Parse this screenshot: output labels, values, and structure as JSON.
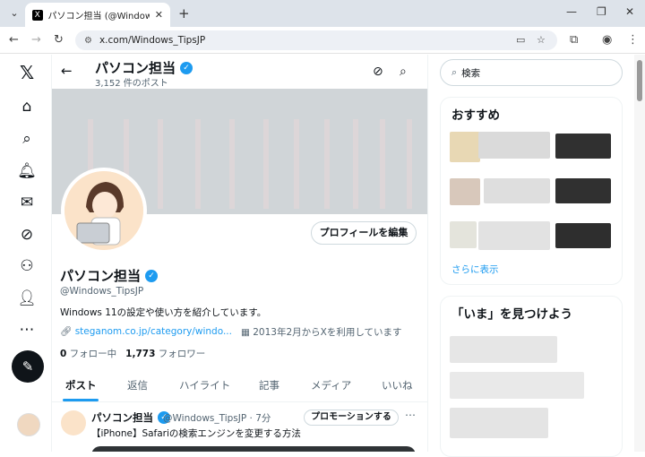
{
  "browser": {
    "tab_title": "パソコン担当 (@Windows_TipsJP)",
    "tab_favicon": "X",
    "url": "x.com/Windows_TipsJP"
  },
  "sidebar_icons": [
    "x-logo-icon",
    "home-icon",
    "explore-icon",
    "notifications-icon",
    "messages-icon",
    "grok-icon",
    "communities-icon",
    "profile-icon",
    "more-icon"
  ],
  "header": {
    "name": "パソコン担当",
    "post_count": "3,152 件のポスト"
  },
  "profile": {
    "edit_label": "プロフィールを編集",
    "name": "パソコン担当",
    "handle": "@Windows_TipsJP",
    "bio": "Windows 11の設定や使い方を紹介しています。",
    "link": "steganom.co.jp/category/windo...",
    "joined": "2013年2月からXを利用しています",
    "following_count": "0",
    "following_label": "フォロー中",
    "followers_count": "1,773",
    "followers_label": "フォロワー"
  },
  "tabs": [
    "ポスト",
    "返信",
    "ハイライト",
    "記事",
    "メディア",
    "いいね"
  ],
  "post": {
    "name": "パソコン担当",
    "meta": "@Windows_TipsJP · 7分",
    "promote_label": "プロモーションする",
    "text": "【iPhone】Safariの検索エンジンを変更する方法"
  },
  "right": {
    "search_placeholder": "検索",
    "recommend_title": "おすすめ",
    "show_more": "さらに表示",
    "trends_title": "「いま」を見つけよう"
  },
  "colors": {
    "accent": "#1d9bf0",
    "text": "#0f1419",
    "muted": "#536471"
  }
}
